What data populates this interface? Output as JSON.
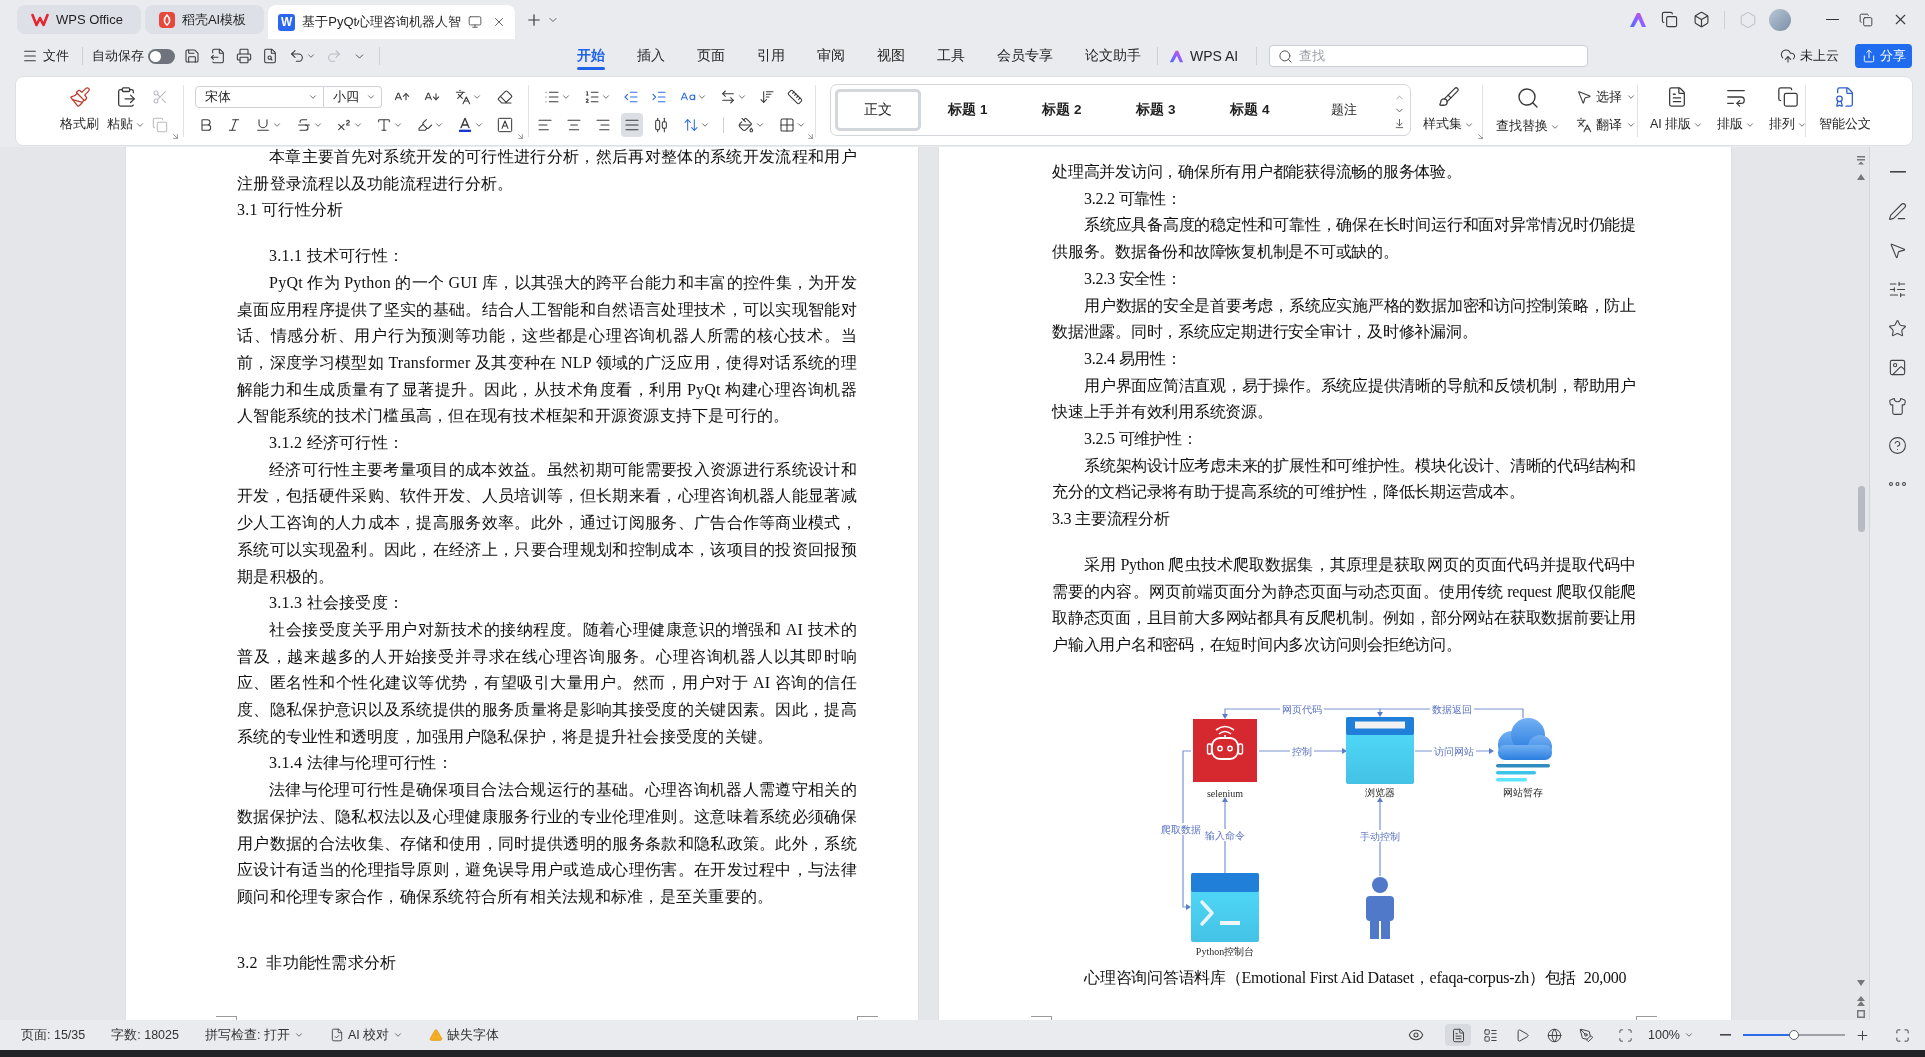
{
  "title_bar": {
    "tabs": [
      {
        "kind": "home",
        "label": "WPS Office",
        "selected": false
      },
      {
        "kind": "template",
        "label": "稻壳AI模板",
        "selected": false
      },
      {
        "kind": "document",
        "label": "基于PyQt心理咨询机器人智",
        "logo_text": "W",
        "selected": true
      }
    ]
  },
  "quick_access": {
    "file_menu": "文件",
    "autosave": {
      "label": "自动保存",
      "on": false
    },
    "redo": {
      "disabled": true
    }
  },
  "menu_tabs": [
    {
      "label": "开始",
      "selected": true
    },
    {
      "label": "插入",
      "selected": false
    },
    {
      "label": "页面",
      "selected": false
    },
    {
      "label": "引用",
      "selected": false
    },
    {
      "label": "审阅",
      "selected": false
    },
    {
      "label": "视图",
      "selected": false
    },
    {
      "label": "工具",
      "selected": false
    },
    {
      "label": "会员专享",
      "selected": false
    },
    {
      "label": "论文助手",
      "selected": false
    }
  ],
  "ai_menu": {
    "label": "WPS AI"
  },
  "search": {
    "placeholder": "查找"
  },
  "cloud_status": "未上云",
  "share_button": "分享",
  "ribbon": {
    "clipboard": {
      "format_painter": "格式刷",
      "paste": "粘贴",
      "cut": {
        "disabled": true
      },
      "copy": {
        "disabled": true
      }
    },
    "font": {
      "family": "宋体",
      "size": "小四"
    },
    "alignment": [
      {
        "kind": "left",
        "selected": false
      },
      {
        "kind": "center",
        "selected": false
      },
      {
        "kind": "right",
        "selected": false
      },
      {
        "kind": "justify",
        "selected": true
      },
      {
        "kind": "distributed",
        "selected": false
      }
    ],
    "styles": [
      {
        "kind": "body",
        "label": "正文",
        "selected": true
      },
      {
        "kind": "heading",
        "label": "标题 1",
        "selected": false
      },
      {
        "kind": "heading",
        "label": "标题 2",
        "selected": false
      },
      {
        "kind": "heading",
        "label": "标题 3",
        "selected": false
      },
      {
        "kind": "heading",
        "label": "标题 4",
        "selected": false
      },
      {
        "kind": "caption",
        "label": "题注",
        "selected": false
      }
    ],
    "style_set": "样式集",
    "find_replace": "查找替换",
    "select": "选择",
    "translate": "翻译",
    "layout_tools": [
      {
        "kind": "ai",
        "label": "AI 排版"
      },
      {
        "kind": "typeset",
        "label": "排版"
      },
      {
        "kind": "arrange",
        "label": "排列"
      }
    ],
    "smart_document": "智能公文"
  },
  "document": {
    "left_page": [
      {
        "kind": "paragraph",
        "text": "本章主要首先对系统开发的可行性进行分析，然后再对整体的系统开发流程和用户注册登录流程以及功能流程进行分析。"
      },
      {
        "kind": "heading",
        "text": "3.1 可行性分析"
      },
      {
        "kind": "subheading",
        "text": "3.1.1 技术可行性："
      },
      {
        "kind": "paragraph",
        "text": "PyQt 作为 Python 的一个 GUI 库，以其强大的跨平台能力和丰富的控件集，为开发桌面应用程序提供了坚实的基础。结合人工智能和自然语言处理技术，可以实现智能对话、情感分析、用户行为预测等功能，这些都是心理咨询机器人所需的核心技术。当前，深度学习模型如 Transformer 及其变种在 NLP 领域的广泛应用，使得对话系统的理解能力和生成质量有了显著提升。因此，从技术角度看，利用 PyQt 构建心理咨询机器人智能系统的技术门槛虽高，但在现有技术框架和开源资源支持下是可行的。"
      },
      {
        "kind": "subheading",
        "text": "3.1.2 经济可行性："
      },
      {
        "kind": "paragraph",
        "text": "经济可行性主要考量项目的成本效益。虽然初期可能需要投入资源进行系统设计和开发，包括硬件采购、软件开发、人员培训等，但长期来看，心理咨询机器人能显著减少人工咨询的人力成本，提高服务效率。此外，通过订阅服务、广告合作等商业模式，系统可以实现盈利。因此，在经济上，只要合理规划和控制成本，该项目的投资回报预期是积极的。"
      },
      {
        "kind": "subheading",
        "text": "3.1.3 社会接受度："
      },
      {
        "kind": "paragraph",
        "text": "社会接受度关乎用户对新技术的接纳程度。随着心理健康意识的增强和 AI 技术的普及，越来越多的人开始接受并寻求在线心理咨询服务。心理咨询机器人以其即时响应、匿名性和个性化建议等优势，有望吸引大量用户。然而，用户对于 AI 咨询的信任度、隐私保护意识以及系统提供的服务质量将是影响其接受度的关键因素。因此，提高系统的专业性和透明度，加强用户隐私保护，将是提升社会接受度的关键。"
      },
      {
        "kind": "subheading",
        "text": "3.1.4 法律与伦理可行性："
      },
      {
        "kind": "paragraph",
        "text": "法律与伦理可行性是确保项目合法合规运行的基础。心理咨询机器人需遵守相关的数据保护法、隐私权法以及心理健康服务行业的专业伦理准则。这意味着系统必须确保用户数据的合法收集、存储和使用，同时提供透明的服务条款和隐私政策。此外，系统应设计有适当的伦理指导原则，避免误导用户或造成心理伤害。在开发过程中，与法律顾问和伦理专家合作，确保系统符合所有相关法规和标准，是至关重要的。"
      },
      {
        "kind": "blank_line"
      },
      {
        "kind": "heading",
        "text": "3.2  非功能性需求分析"
      }
    ],
    "right_page": [
      {
        "kind": "continuation",
        "text": "处理高并发访问，确保所有用户都能获得流畅的服务体验。"
      },
      {
        "kind": "subheading",
        "text": "3.2.2 可靠性："
      },
      {
        "kind": "paragraph",
        "text": "系统应具备高度的稳定性和可靠性，确保在长时间运行和面对异常情况时仍能提供服务。数据备份和故障恢复机制是不可或缺的。"
      },
      {
        "kind": "subheading",
        "text": "3.2.3 安全性："
      },
      {
        "kind": "paragraph",
        "text": "用户数据的安全是首要考虑，系统应实施严格的数据加密和访问控制策略，防止数据泄露。同时，系统应定期进行安全审计，及时修补漏洞。"
      },
      {
        "kind": "subheading",
        "text": "3.2.4 易用性："
      },
      {
        "kind": "paragraph",
        "text": "用户界面应简洁直观，易于操作。系统应提供清晰的导航和反馈机制，帮助用户快速上手并有效利用系统资源。"
      },
      {
        "kind": "subheading",
        "text": "3.2.5 可维护性："
      },
      {
        "kind": "paragraph",
        "text": "系统架构设计应考虑未来的扩展性和可维护性。模块化设计、清晰的代码结构和充分的文档记录将有助于提高系统的可维护性，降低长期运营成本。"
      },
      {
        "kind": "heading",
        "text": "3.3 主要流程分析"
      },
      {
        "kind": "paragraph",
        "text": "采用 Python 爬虫技术爬取数据集，其原理是获取网页的页面代码并提取代码中需要的内容。网页前端页面分为静态页面与动态页面。使用传统 request 爬取仅能爬取静态页面，且目前大多网站都具有反爬机制。例如，部分网站在获取数据前要让用户输入用户名和密码，在短时间内多次访问则会拒绝访问。"
      },
      {
        "kind": "figure",
        "nodes": [
          {
            "kind": "robot",
            "label": "selenium"
          },
          {
            "kind": "browser",
            "label": "浏览器"
          },
          {
            "kind": "cloud",
            "label": "网站暂存"
          },
          {
            "kind": "terminal",
            "label": "Python控制台"
          },
          {
            "kind": "person"
          }
        ],
        "edges": [
          {
            "label": "网页代码"
          },
          {
            "label": "数据返回"
          },
          {
            "label": "控制"
          },
          {
            "label": "访问网站"
          },
          {
            "label": "爬取数据"
          },
          {
            "label": "输入命令"
          },
          {
            "label": "手动控制"
          }
        ]
      },
      {
        "kind": "cut_off",
        "text": "心理咨询问答语料库（Emotional First Aid Dataset，efaqa-corpus-zh）包括  20,000"
      }
    ]
  },
  "status_bar": {
    "page": "页面: 15/35",
    "word_count": "字数: 18025",
    "spell_check": "拼写检查: 打开",
    "ai_proofread": "AI 校对",
    "missing_fonts": "缺失字体",
    "views": [
      {
        "kind": "page",
        "selected": true
      },
      {
        "kind": "outline",
        "selected": false
      },
      {
        "kind": "slideshow",
        "selected": false
      },
      {
        "kind": "web",
        "selected": false
      },
      {
        "kind": "writing",
        "selected": false
      }
    ],
    "zoom": "100%",
    "zoom_slider": {
      "level": 0.5
    }
  }
}
